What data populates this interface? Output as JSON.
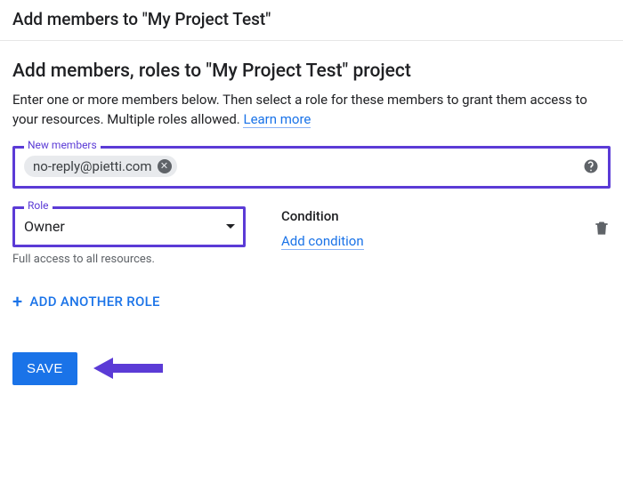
{
  "dialog": {
    "title": "Add members to \"My Project Test\""
  },
  "section": {
    "heading": "Add members, roles to \"My Project Test\" project",
    "description_part1": "Enter one or more members below. Then select a role for these members to grant them access to your resources. Multiple roles allowed. ",
    "learn_more_label": "Learn more"
  },
  "members_field": {
    "legend": "New members",
    "chips": [
      {
        "email": "no-reply@pietti.com"
      }
    ]
  },
  "role_field": {
    "legend": "Role",
    "selected": "Owner",
    "helper": "Full access to all resources."
  },
  "condition": {
    "label": "Condition",
    "add_label": "Add condition"
  },
  "add_role_button": {
    "label": "ADD ANOTHER ROLE"
  },
  "footer": {
    "save_label": "SAVE"
  }
}
